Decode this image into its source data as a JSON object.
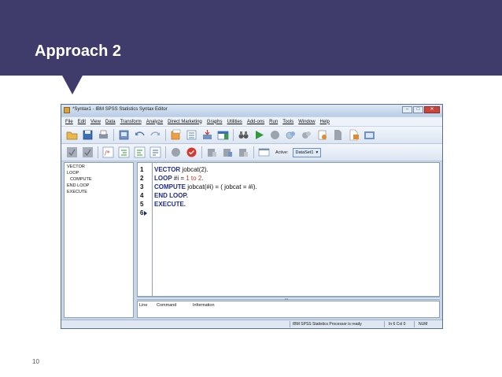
{
  "slide": {
    "title": "Approach 2",
    "page_number": "10"
  },
  "window": {
    "title": "*Syntax1 - IBM SPSS Statistics Syntax Editor",
    "controls": [
      "–",
      "□",
      "✕"
    ]
  },
  "menu": [
    "File",
    "Edit",
    "View",
    "Data",
    "Transform",
    "Analyze",
    "Direct Marketing",
    "Graphs",
    "Utilities",
    "Add-ons",
    "Run",
    "Tools",
    "Window",
    "Help"
  ],
  "toolbar": {
    "active_label": "Active:",
    "dataset_value": "DataSet1"
  },
  "navigator": [
    "VECTOR",
    "LOOP",
    "COMPUTE",
    "END LOOP",
    "EXECUTE"
  ],
  "editor": {
    "line_numbers": [
      "1",
      "2",
      "3",
      "4",
      "5",
      "6"
    ],
    "lines": [
      {
        "kw": "VECTOR",
        "rest": " jobcat(2)."
      },
      {
        "kw": "LOOP",
        "rest_a": " #i = ",
        "num1": "1",
        "mid": " to ",
        "num2": "2",
        "rest_b": "."
      },
      {
        "kw": "COMPUTE",
        "rest": " jobcat(#i) = ( jobcat = #i)."
      },
      {
        "kw": "END LOOP."
      },
      {
        "kw": "EXECUTE."
      }
    ]
  },
  "info_pane": {
    "headers": [
      "Line",
      "Command",
      "Information"
    ]
  },
  "statusbar": {
    "processor": "IBM SPSS Statistics Processor is ready",
    "position": "In 6 Col 0",
    "num": "NUM"
  },
  "colors": {
    "banner": "#3f3b6b",
    "keyword": "#1d2b8f",
    "number": "#c0392b"
  }
}
